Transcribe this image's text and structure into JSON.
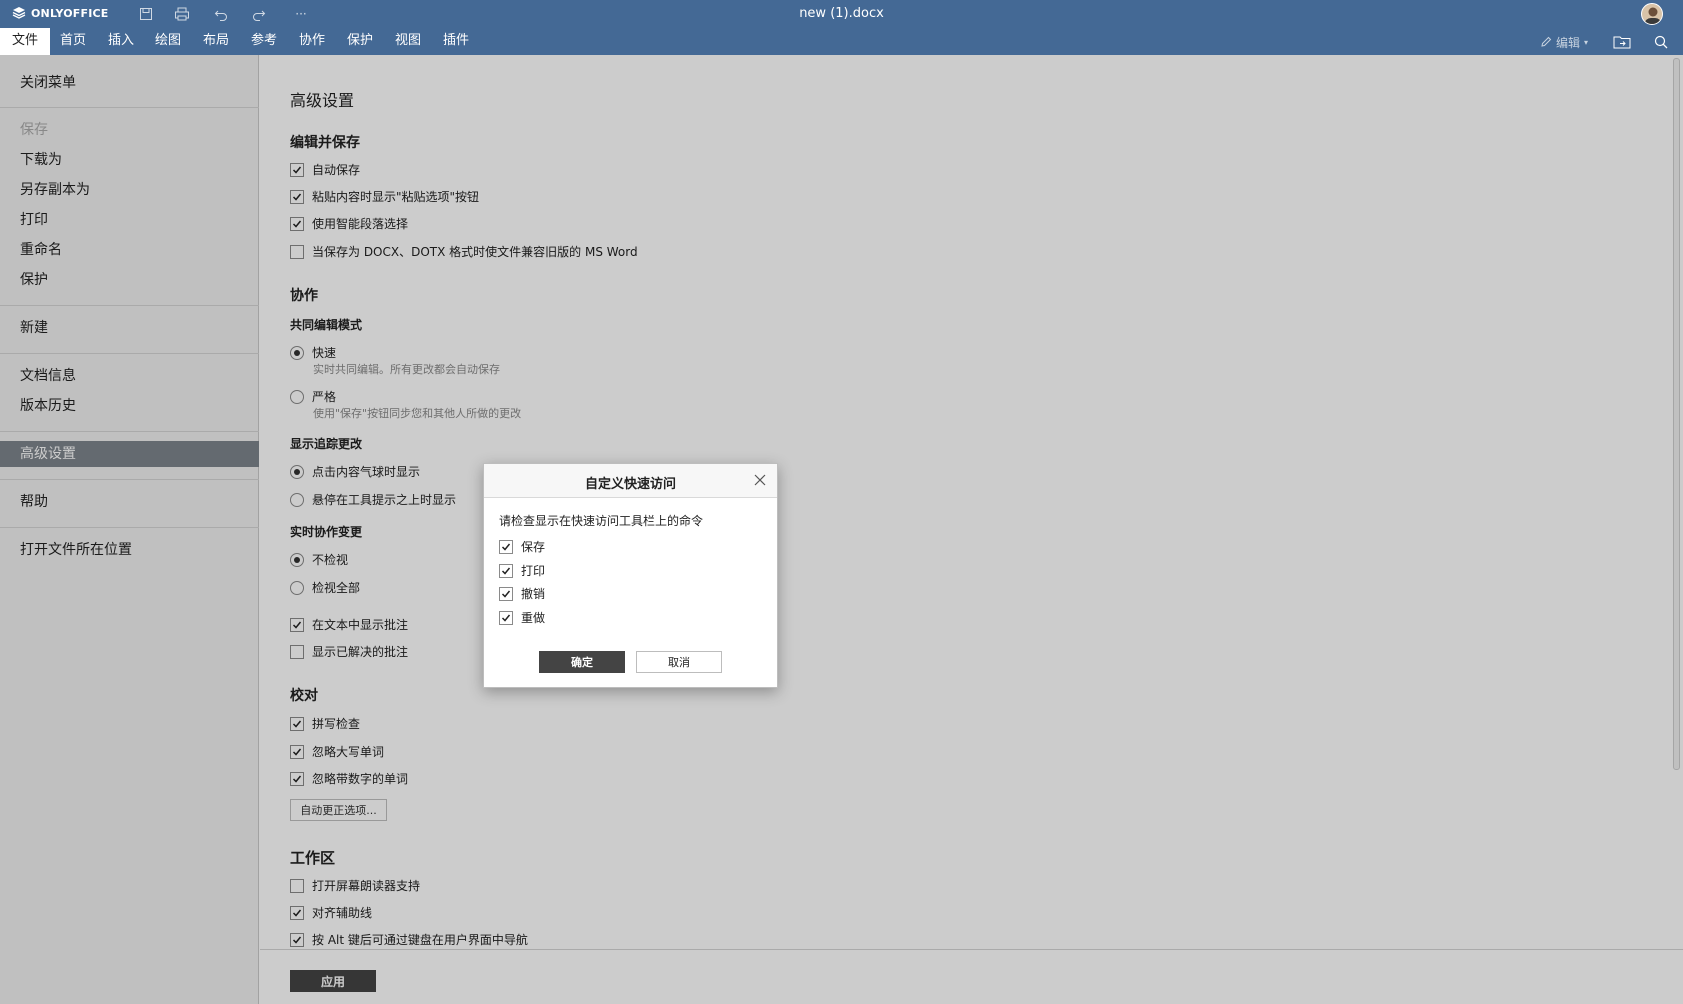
{
  "titlebar": {
    "brand": "ONLYOFFICE",
    "doc_title": "new (1).docx",
    "more_label": "···"
  },
  "tabs": [
    "文件",
    "首页",
    "插入",
    "绘图",
    "布局",
    "参考",
    "协作",
    "保护",
    "视图",
    "插件"
  ],
  "toolbar_right": {
    "edit_label": "编辑"
  },
  "left_menu": {
    "close": "关闭菜单",
    "save": "保存",
    "download_as": "下载为",
    "save_copy": "另存副本为",
    "print": "打印",
    "rename": "重命名",
    "protect": "保护",
    "new": "新建",
    "doc_info": "文档信息",
    "version_history": "版本历史",
    "advanced_settings": "高级设置",
    "help": "帮助",
    "open_location": "打开文件所在位置"
  },
  "settings": {
    "title": "高级设置",
    "edit_save": {
      "heading": "编辑并保存",
      "autosave": "自动保存",
      "paste_options": "粘贴内容时显示\"粘贴选项\"按钮",
      "smart_paragraph": "使用智能段落选择",
      "compat": "当保存为 DOCX、DOTX 格式时使文件兼容旧版的 MS Word"
    },
    "collab": {
      "heading": "协作",
      "mode_label": "共同编辑模式",
      "fast": "快速",
      "fast_desc": "实时共同编辑。所有更改都会自动保存",
      "strict": "严格",
      "strict_desc": "使用\"保存\"按钮同步您和其他人所做的更改",
      "track_label": "显示追踪更改",
      "track_click": "点击内容气球时显示",
      "track_hover": "悬停在工具提示之上时显示",
      "realtime_label": "实时协作变更",
      "view_none": "不检视",
      "view_all": "检视全部",
      "show_comments": "在文本中显示批注",
      "show_resolved": "显示已解决的批注"
    },
    "proofing": {
      "heading": "校对",
      "spellcheck": "拼写检查",
      "ignore_upper": "忽略大写单词",
      "ignore_numbers": "忽略带数字的单词",
      "autocorrect_btn": "自动更正选项..."
    },
    "workspace": {
      "heading": "工作区",
      "screen_reader": "打开屏幕朗读器支持",
      "align_guides": "对齐辅助线",
      "alt_nav": "按 Alt 键后可通过键盘在用户界面中导航"
    },
    "apply_btn": "应用"
  },
  "dialog": {
    "title": "自定义快速访问",
    "description": "请检查显示在快速访问工具栏上的命令",
    "items": [
      "保存",
      "打印",
      "撤销",
      "重做"
    ],
    "ok": "确定",
    "cancel": "取消"
  },
  "colors": {
    "header_bg": "#446995",
    "active_menu_bg": "#7d858c",
    "primary_btn": "#444444"
  }
}
